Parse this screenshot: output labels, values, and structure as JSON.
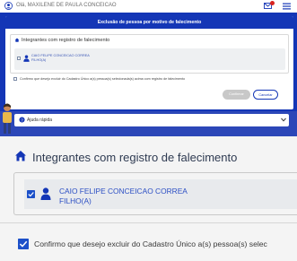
{
  "header": {
    "greeting": "Olá, MAXILENE DE PAULA CONCEICAO"
  },
  "modal": {
    "title": "Exclusão de pessoa por motivo de falecimento",
    "section_title": "Integrantes com registro de falecimento",
    "member": {
      "name": "CAIO FELIPE CONCEICAO CORREA",
      "role": "FILHO(A)",
      "checked": false
    },
    "confirm_text": "Confirmo que desejo excluir do Cadastro Único a(s) pessoa(s) selecionada(s) acima com registro de falecimento",
    "confirm_checked": false,
    "confirm_button": "Confirmar",
    "cancel_button": "Cancelar"
  },
  "help": {
    "label": "Ajuda rápida"
  },
  "zoom": {
    "section_title": "Integrantes com registro de falecimento",
    "member": {
      "name": "CAIO FELIPE CONCEICAO CORREA",
      "role": "FILHO(A)",
      "checked": true
    },
    "confirm_text": "Confirmo que desejo excluir do Cadastro Único a(s) pessoa(s) selec",
    "confirm_checked": true
  },
  "icons": {
    "user": "user-icon",
    "mail": "mail-icon",
    "menu": "menu-icon",
    "house": "house-icon",
    "person": "person-icon",
    "question": "question-icon",
    "chevron": "chevron-down-icon"
  },
  "colors": {
    "primary": "#1436b6",
    "checkbox": "#1c50c9",
    "name_text": "#2c4fc4",
    "badge": "#d9231f"
  }
}
